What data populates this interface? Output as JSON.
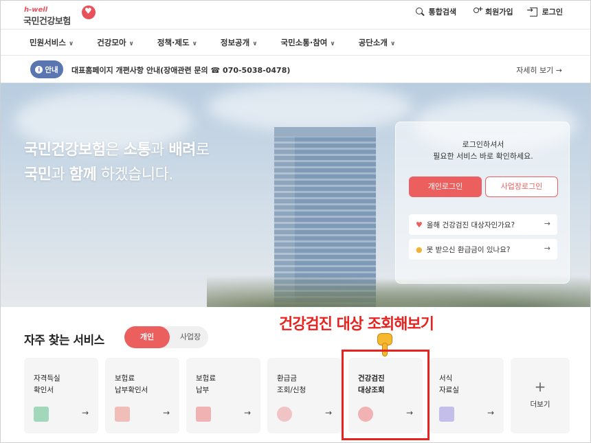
{
  "header": {
    "logo_small": "h-well",
    "logo_main": "국민건강보험",
    "util": [
      "통합검색",
      "회원가입",
      "로그인"
    ]
  },
  "gnb": [
    "민원서비스",
    "건강모아",
    "정책·제도",
    "정보공개",
    "국민소통·참여",
    "공단소개"
  ],
  "notice": {
    "badge": "안내",
    "text": "대표홈페이지 개편사항 안내(장애관련 문의 ☎ 070-5038-0478)",
    "more": "자세히 보기 →"
  },
  "hero": {
    "line1_a": "국민건강보험",
    "line1_b": "은 ",
    "line1_c": "소통",
    "line1_d": "과 ",
    "line1_e": "배려",
    "line1_f": "로",
    "line2_a": "국민",
    "line2_b": "과 ",
    "line2_c": "함께",
    "line2_d": " 하겠습니다."
  },
  "login": {
    "msg1": "로그인하셔서",
    "msg2": "필요한 서비스 바로 확인하세요.",
    "personal": "개인로그인",
    "business": "사업장로그인",
    "q1": "올해 건강검진 대상자인가요?",
    "q2": "못 받으신 환급금이 있나요?"
  },
  "services": {
    "title": "자주 찾는 서비스",
    "tab_on": "개인",
    "tab_off": "사업장",
    "cards": [
      {
        "label": "자격득실\n확인서",
        "color": "#5bbf8a"
      },
      {
        "label": "보험료\n납부확인서",
        "color": "#ec7b6e"
      },
      {
        "label": "보험료\n납부",
        "color": "#ec6f6f"
      },
      {
        "label": "환급금\n조회/신청",
        "color": "#ec8a8a"
      },
      {
        "label": "건강검진\n대상조회",
        "color": "#ec6f6f"
      },
      {
        "label": "서식\n자료실",
        "color": "#9b8fe0"
      }
    ],
    "more": "더보기",
    "plus": "+",
    "arrow": "→"
  },
  "annotation": {
    "callout": "건강검진 대상 조회해보기"
  }
}
